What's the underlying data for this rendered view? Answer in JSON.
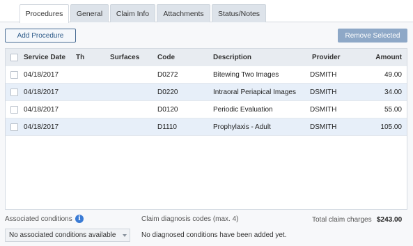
{
  "tabs": [
    {
      "label": "Procedures",
      "active": true
    },
    {
      "label": "General"
    },
    {
      "label": "Claim Info"
    },
    {
      "label": "Attachments"
    },
    {
      "label": "Status/Notes"
    }
  ],
  "toolbar": {
    "add_label": "Add Procedure",
    "remove_label": "Remove Selected"
  },
  "table": {
    "columns": [
      "Service Date",
      "Th",
      "Surfaces",
      "Code",
      "Description",
      "Provider",
      "Amount"
    ],
    "rows": [
      {
        "date": "04/18/2017",
        "th": "",
        "surfaces": "",
        "code": "D0272",
        "description": "Bitewing Two Images",
        "provider": "DSMITH",
        "amount": "49.00"
      },
      {
        "date": "04/18/2017",
        "th": "",
        "surfaces": "",
        "code": "D0220",
        "description": "Intraoral Periapical Images",
        "provider": "DSMITH",
        "amount": "34.00"
      },
      {
        "date": "04/18/2017",
        "th": "",
        "surfaces": "",
        "code": "D0120",
        "description": "Periodic Evaluation",
        "provider": "DSMITH",
        "amount": "55.00"
      },
      {
        "date": "04/18/2017",
        "th": "",
        "surfaces": "",
        "code": "D1110",
        "description": "Prophylaxis - Adult",
        "provider": "DSMITH",
        "amount": "105.00"
      }
    ]
  },
  "footer": {
    "associated_label": "Associated conditions",
    "info_glyph": "i",
    "associated_select_value": "No associated conditions available",
    "diagnosis_label": "Claim diagnosis codes (max. 4)",
    "diagnosis_empty": "No diagnosed conditions have been added yet.",
    "total_label": "Total claim charges",
    "total_value": "$243.00"
  },
  "colors": {
    "accent": "#2f5c8a",
    "remove_button": "#8ea8c7",
    "row_alt": "#e7eff9",
    "header_bg": "#e8ecf1",
    "info_icon": "#3a7bd5"
  }
}
